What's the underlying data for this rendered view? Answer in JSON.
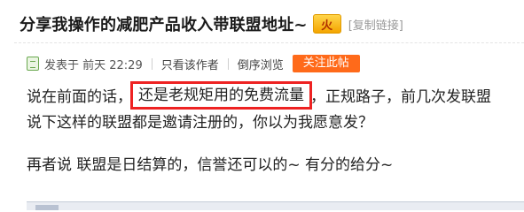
{
  "post": {
    "title": "分享我操作的减肥产品收入带联盟地址~",
    "hot_badge": "火",
    "copy_link": "[复制链接]"
  },
  "meta": {
    "posted": "发表于 前天 22:29",
    "author_only": "只看该作者",
    "reverse": "倒序浏览",
    "follow": "关注此帖"
  },
  "body": {
    "line1_before": "说在前面的话，",
    "line1_highlight": "还是老规矩用的免费流量",
    "line1_after": "，正规路子，前几次发联盟",
    "line2": "说下这样的联盟都是邀请注册的，你以为我愿意发？",
    "line3": "再者说 联盟是日结算的，信誉还可以的~ 有分的给分~"
  }
}
